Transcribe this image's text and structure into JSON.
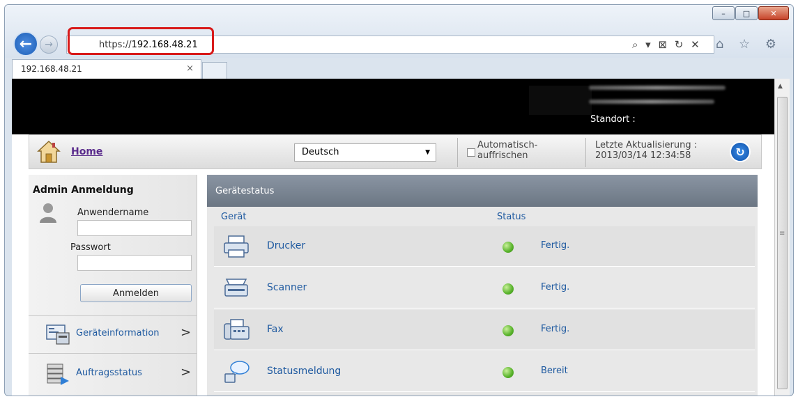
{
  "browser": {
    "url_prefix": "https://",
    "url_host": "192.168.48.21",
    "tab_title": "192.168.48.21",
    "tab_close": "×",
    "addr_tools": "⌕ ▾ ⊠ ↻ ✕",
    "right_tools": "⌂ ☆ ⚙",
    "win_minimize": "–",
    "win_maximize": "□",
    "win_close": "✕",
    "back": "←",
    "forward": "→"
  },
  "header": {
    "standort_label": "Standort :"
  },
  "topbar": {
    "home_label": "Home",
    "language_selected": "Deutsch",
    "auto_refresh_line1": "Automatisch-",
    "auto_refresh_line2": "auffrischen",
    "last_update_line1": "Letzte Aktualisierung :",
    "last_update_line2": "2013/03/14 12:34:58"
  },
  "sidebar": {
    "admin_title": "Admin Anmeldung",
    "username_label": "Anwendername",
    "password_label": "Passwort",
    "login_button": "Anmelden",
    "items": [
      {
        "label": "Geräteinformation",
        "chevron": ">"
      },
      {
        "label": "Auftragsstatus",
        "chevron": ">"
      }
    ]
  },
  "panel": {
    "title": "Gerätestatus",
    "col_device": "Gerät",
    "col_status": "Status",
    "rows": [
      {
        "device": "Drucker",
        "status": "Fertig."
      },
      {
        "device": "Scanner",
        "status": "Fertig."
      },
      {
        "device": "Fax",
        "status": "Fertig."
      },
      {
        "device": "Statusmeldung",
        "status": "Bereit"
      }
    ]
  },
  "colors": {
    "accent_blue": "#1f5aa0",
    "ready_green": "#57b22a",
    "highlight_red": "#d81a1a"
  }
}
